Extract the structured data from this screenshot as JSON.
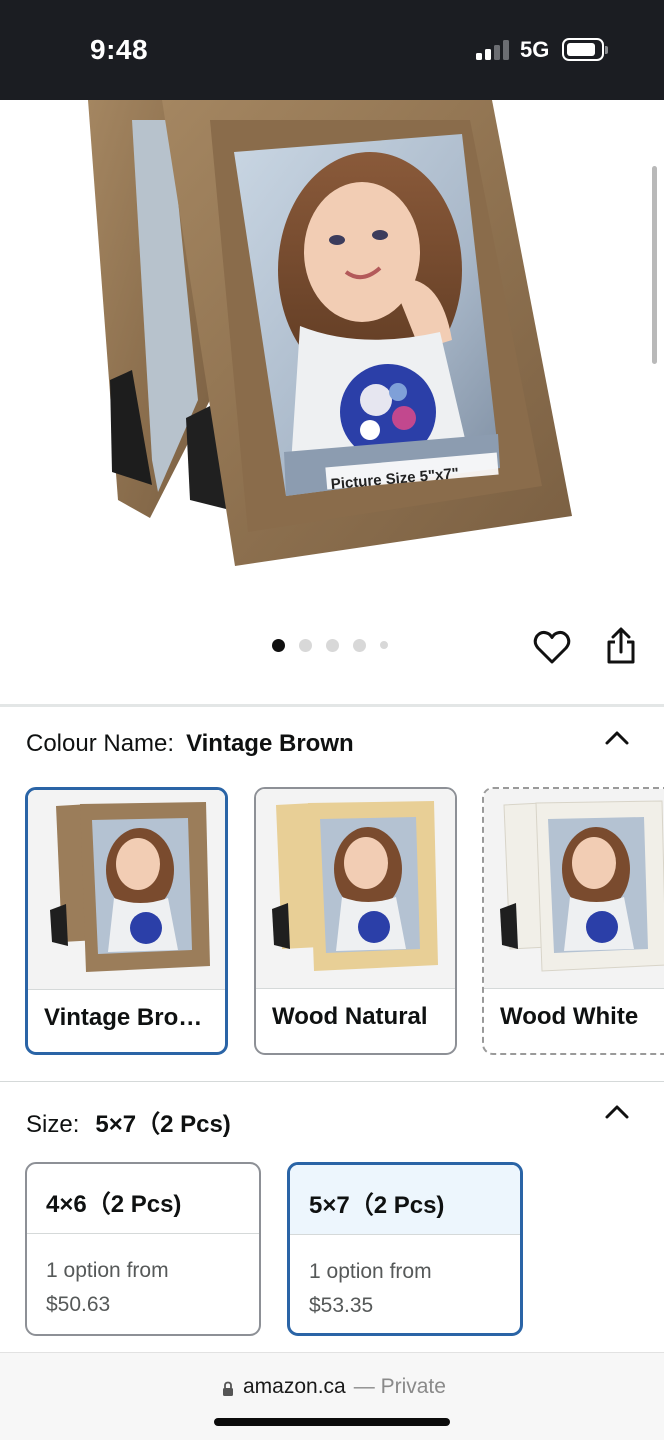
{
  "status_bar": {
    "time": "9:48",
    "network": "5G",
    "icons": [
      "signal-icon",
      "battery-icon"
    ]
  },
  "hero": {
    "image_caption": "Picture Size 5\"x7\"",
    "carousel_position": 1,
    "carousel_total": 5
  },
  "actions": {
    "icons": [
      "heart-icon",
      "share-icon"
    ]
  },
  "colour": {
    "label": "Colour Name:",
    "selected": "Vintage Brown",
    "options": [
      {
        "label": "Vintage Bro…",
        "state": "selected",
        "frame_color": "#9b7d5a"
      },
      {
        "label": "Wood Natural",
        "state": "available",
        "frame_color": "#e8cf96"
      },
      {
        "label": "Wood White",
        "state": "unavailable",
        "frame_color": "#f1efe8"
      }
    ]
  },
  "size": {
    "label": "Size:",
    "selected": "5×7（2 Pcs)",
    "options": [
      {
        "title": "4×6（2 Pcs)",
        "line1": "1 option from",
        "price": "$50.63",
        "state": "available"
      },
      {
        "title": "5×7（2 Pcs)",
        "line1": "1 option from",
        "price": "$53.35",
        "state": "selected"
      }
    ]
  },
  "url_bar": {
    "domain": "amazon.ca",
    "separator": "—",
    "mode": "Private"
  },
  "colors": {
    "selected_border": "#2a64a6",
    "selected_fill": "#edf6fd",
    "status_bar_bg": "#1b1d22"
  }
}
